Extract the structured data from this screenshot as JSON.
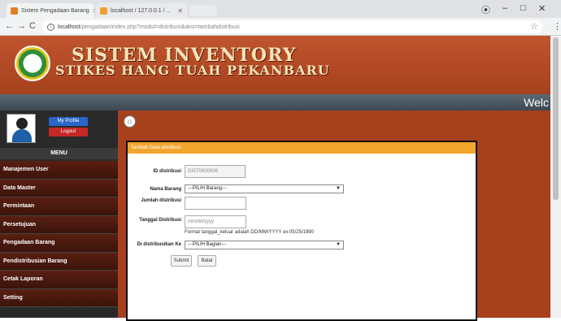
{
  "tabs": [
    {
      "title": "Sistem Pengadaan Barang",
      "active": true
    },
    {
      "title": "localhost / 127.0.0.1 / ...",
      "active": false
    }
  ],
  "window": {
    "account": "⦿",
    "minimize": "–",
    "maximize": "□",
    "close": "✕"
  },
  "address": {
    "host": "localhost",
    "path": "/pengadaan/index.php?modul=distribusi&aksi=tambahdistribusi"
  },
  "header": {
    "title": "SISTEM INVENTORY",
    "subtitle": "STIKES HANG TUAH PEKANBARU",
    "welcome": "Welc"
  },
  "user": {
    "profile_label": "My Profile",
    "logout_label": "Logout"
  },
  "menu": {
    "heading": "MENU",
    "items": [
      "Manajemen User",
      "Data Master",
      "Permintaan",
      "Persetujuan",
      "Pengadaan Barang",
      "Pendistribusian Barang",
      "Cetak Laporan",
      "Setting"
    ]
  },
  "form": {
    "heading": "Tambah Data distribusi",
    "id_label": "ID distribusi",
    "id_value": "DIST0000006",
    "barang_label": "Nama Barang",
    "barang_selected": "---PILIH Barang---",
    "jumlah_label": "Jumlah distribusi",
    "jumlah_value": "",
    "tanggal_label": "Tanggal Distribusi",
    "tanggal_placeholder": "mm/dd/yyyy",
    "tanggal_hint": "Format tanggal_keluar adalah DD/MM/YYYY ex:05/25/1990",
    "bagian_label": "Di distribusikan Ke",
    "bagian_selected": "---PILIH Bagian---",
    "submit_label": "Submit",
    "batal_label": "Batal"
  },
  "colors": {
    "brand": "#a6401d",
    "panel_header": "#f2a62d",
    "sidebar": "#2a2a2a"
  }
}
